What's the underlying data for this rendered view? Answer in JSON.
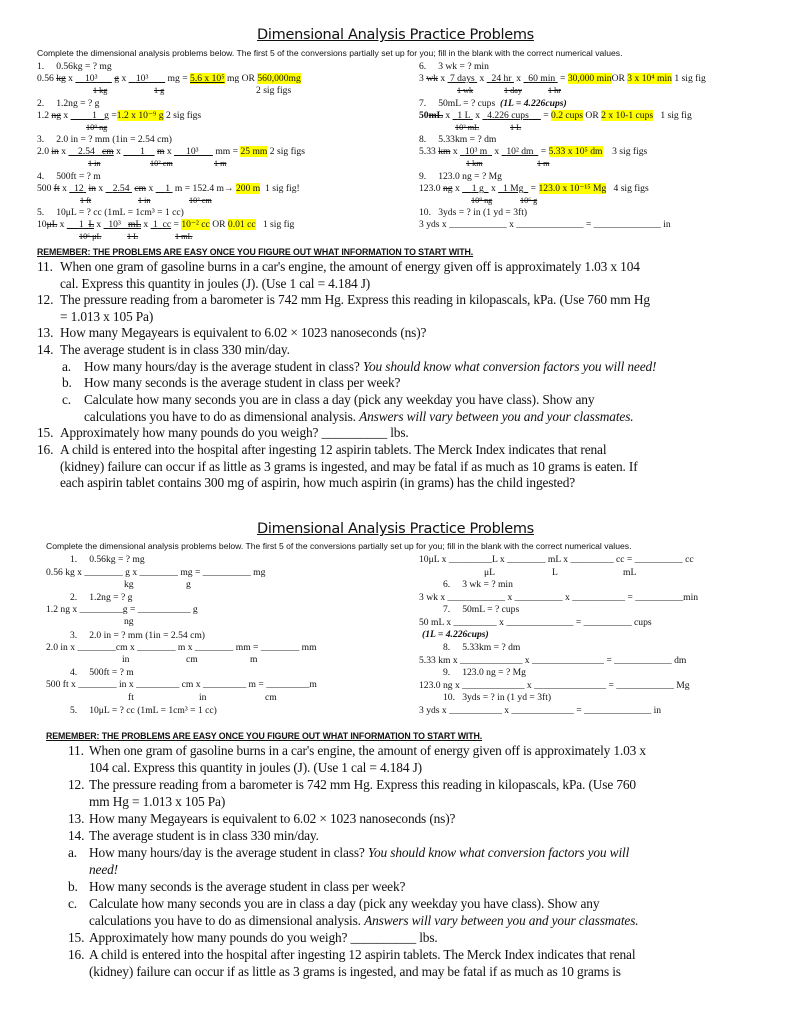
{
  "worksheet_title": "Dimensional Analysis Practice Problems",
  "instructions": "Complete the dimensional analysis problems below.  The first 5 of the conversions partially set up for you; fill in the blank with the correct numerical values.",
  "highlight_color": "#ffff00",
  "answer_key": {
    "p1": {
      "head": "1.     0.56kg = ? mg",
      "start": "0.56 ",
      "start_unit": "kg",
      "x": " x ",
      "f1_num": "10³",
      "f1_unit": "g",
      "f1_den": "1 kg",
      "f2_num": "10³",
      "f2_unit": "mg =",
      "f2_den": "1 g",
      "answer": "5.6 x 10⁵",
      "after": " mg OR ",
      "answer2": "560,000mg",
      "sig": "2 sig figs"
    },
    "p2": {
      "head": "2.     1.2ng = ? g",
      "start": "1.2 ",
      "start_unit": "ng",
      "f1_num": "1",
      "f1_den": "10⁹ ng",
      "eq": "g =",
      "answer": "1.2 x 10⁻⁹ g",
      "sig": "2 sig figs"
    },
    "p3": {
      "head": "3.     2.0 in = ? mm (1in = 2.54 cm)",
      "start": "2.0 ",
      "start_unit": "in",
      "f1_num": "2.54",
      "f1_unit": "cm",
      "f1_den": "1 in",
      "f2_num": "1",
      "f2_unit": "m",
      "f2_den": "10² cm",
      "f3_num": "10³",
      "f3_unit": "mm =",
      "f3_den": "1 m",
      "answer": "25 mm",
      "sig": "2 sig figs"
    },
    "p4": {
      "head": "4.     500ft = ? m",
      "start": "500 ",
      "start_unit": "ft",
      "f1_num": "12",
      "f1_unit": "in",
      "f1_den": "1 ft",
      "f2_num": "2.54",
      "f2_unit": "cm",
      "f2_den": "1 in",
      "f3_num": "1",
      "f3_unit": "m = 152.4 m→ ",
      "f3_den": "10² cm",
      "answer": "200 m",
      "sig": "1 sig fig!"
    },
    "p5": {
      "head": "5.     10μL = ? cc (1mL = 1cm³ = 1 cc)",
      "start": "10",
      "start_unit": "μL",
      "f1_num": "1",
      "f1_unit": "L",
      "f1_den": "10⁶ μL",
      "f2_num": "10³",
      "f2_unit": "mL",
      "f2_den": "1 L",
      "f3_num": "1",
      "f3_unit": "cc",
      "f3_den": "1 mL",
      "answer": "10⁻² cc",
      "or": " OR ",
      "answer2": "0.01 cc",
      "sig": "1 sig fig"
    },
    "p6": {
      "head": "6.     3 wk = ? min",
      "start": "3 ",
      "start_unit": "wk",
      "f1_num": "7 days",
      "f1_den": "1 wk",
      "f2_num": "24 hr",
      "f2_den": "1 day",
      "f3_num": "60 min",
      "f3_den": "1 hr",
      "answer": "30,000 min",
      "or": "OR ",
      "answer2": "3 x 10⁴ min",
      "sig": "1 sig fig"
    },
    "p7": {
      "head": "7.     50mL = ? cups",
      "note": "(1L = 4.226cups)",
      "start": "50",
      "start_unit": "mL",
      "f1_num": "1 L",
      "f1_den": "10³ mL",
      "f2_num": "4.226 cups",
      "f2_den": "1 L",
      "answer": "0.2 cups",
      "or": " OR ",
      "answer2": "2 x 10-1 cups",
      "sig": "1 sig fig"
    },
    "p8": {
      "head": "8.     5.33km = ? dm",
      "start": "5.33 ",
      "start_unit": "km",
      "f1_num": "10³ m",
      "f1_den": "1 km",
      "f2_num": "10² dm",
      "f2_den": "1 m",
      "answer": "5.33 x 10⁵ dm",
      "sig": "3 sig figs"
    },
    "p9": {
      "head": "9.     123.0 ng = ? Mg",
      "start": "123.0 ",
      "start_unit": "ng",
      "f1_num": "1 g",
      "f1_den": "10⁹ ng",
      "f2_num": "1 Mg",
      "f2_den": "10⁶ g",
      "answer": "123.0 x 10⁻¹⁵ Mg",
      "sig": "4 sig figs"
    },
    "p10": {
      "head": "10.   3yds = ? in (1 yd = 3ft)",
      "line": "3 yds x ____________ x ______________ = ______________ in"
    }
  },
  "blank_sheet": {
    "p1": {
      "head": "1.     0.56kg = ? mg",
      "line": "0.56 kg x ________ g x ________ mg = __________ mg",
      "units": [
        "kg",
        "g"
      ]
    },
    "p2": {
      "head": "2.     1.2ng = ? g",
      "line": "1.2 ng x _________g = ___________ g",
      "units": [
        "ng"
      ]
    },
    "p3": {
      "head": "3.     2.0 in = ? mm (1in = 2.54 cm)",
      "line": "2.0 in x ________cm x ________ m x ________ mm = ________ mm",
      "units": [
        "in",
        "cm",
        "m"
      ]
    },
    "p4": {
      "head": "4.     500ft = ? m",
      "line": "500 ft x ________ in x _________ cm x _________ m = _________m",
      "units": [
        "ft",
        "in",
        "cm"
      ]
    },
    "p5": {
      "head": "5.     10μL = ? cc (1mL = 1cm³ = 1 cc)",
      "line": "10μL x _________L x ________ mL x _________ cc = __________ cc",
      "units": [
        "μL",
        "L",
        "mL"
      ]
    },
    "p6": {
      "head": "6.     3 wk = ? min",
      "line": "3 wk x ____________ x __________ x ___________ = __________min"
    },
    "p7": {
      "head": "7.     50mL = ? cups",
      "line": "50 mL x _________ x ______________ = __________ cups",
      "note": "(1L = 4.226cups)"
    },
    "p8": {
      "head": "8.     5.33km = ? dm",
      "line": "5.33 km x _____________ x _______________ = ____________ dm"
    },
    "p9": {
      "head": "9.     123.0 ng = ? Mg",
      "line": "123.0 ng x _____________ x _______________ = ____________ Mg"
    },
    "p10": {
      "head": "10.   3yds = ? in (1 yd = 3ft)",
      "line": "3 yds x ___________ x _____________ = ______________ in"
    }
  },
  "remember": "REMEMBER: THE PROBLEMS ARE EASY ONCE YOU FIGURE OUT WHAT INFORMATION TO START WITH.",
  "questions_top": [
    {
      "num": "11.",
      "lines": [
        "When one gram of gasoline burns in a car's engine, the amount of energy given off is approximately 1.03 x 104",
        "cal. Express this quantity in joules (J). (Use 1 cal = 4.184 J)"
      ]
    },
    {
      "num": "12.",
      "lines": [
        "The pressure reading from a barometer is 742 mm Hg. Express this reading in kilopascals, kPa. (Use 760 mm Hg",
        "= 1.013 x 105 Pa)"
      ]
    },
    {
      "num": "13.",
      "lines": [
        "How many Megayears is equivalent to 6.02 × 1023 nanoseconds (ns)?"
      ]
    },
    {
      "num": "14.",
      "lines": [
        "The average student is in class 330 min/day."
      ]
    },
    {
      "num": "a.",
      "text": "How many hours/day is the average student in class? ",
      "italic": "You should know what conversion factors you will need!"
    },
    {
      "num": "b.",
      "lines": [
        "How many seconds is the average student in class per week?"
      ]
    },
    {
      "num": "c.",
      "line1": "Calculate how many seconds you are in class a day (pick any weekday you have class).  Show any",
      "line2": "calculations you have to do as dimensional analysis. ",
      "italic": "Answers will vary between you and your classmates."
    },
    {
      "num": "15.",
      "lines": [
        "Approximately how many pounds do you weigh? __________ lbs."
      ]
    },
    {
      "num": "16.",
      "lines": [
        "A child is entered into the hospital after ingesting 12 aspirin tablets. The Merck Index indicates that renal",
        "(kidney) failure can occur if as little as 3 grams is ingested, and may be fatal if as much as 10 grams is eaten. If",
        "each aspirin tablet contains 300 mg of aspirin, how much aspirin (in grams) has the child ingested?"
      ]
    }
  ],
  "questions_bottom": [
    {
      "num": "11.",
      "lines": [
        "When one gram of gasoline burns in a car's engine, the amount of energy given off is approximately 1.03 x",
        "104 cal. Express this quantity in joules (J). (Use 1 cal = 4.184 J)"
      ]
    },
    {
      "num": "12.",
      "lines": [
        "The pressure reading from a barometer is 742 mm Hg. Express this reading in kilopascals, kPa. (Use 760",
        "mm Hg = 1.013 x 105 Pa)"
      ]
    },
    {
      "num": "13.",
      "lines": [
        "How many Megayears is equivalent to 6.02 × 1023 nanoseconds (ns)?"
      ]
    },
    {
      "num": "14.",
      "lines": [
        "The average student is in class 330 min/day."
      ]
    },
    {
      "num": "a.",
      "text": "How many hours/day is the average student in class? ",
      "italic": "You should know what conversion factors you will",
      "italic2": "need!"
    },
    {
      "num": "b.",
      "lines": [
        "How many seconds is the average student in class per week?"
      ]
    },
    {
      "num": "c.",
      "line1": "Calculate how many seconds you are in class a day (pick any weekday you have class).  Show any",
      "line2": "calculations you have to do as dimensional analysis. ",
      "italic": "Answers will vary between you and your classmates."
    },
    {
      "num": "15.",
      "lines": [
        "Approximately how many pounds do you weigh? __________ lbs."
      ]
    },
    {
      "num": "16.",
      "lines": [
        "A child is entered into the hospital after ingesting 12 aspirin tablets. The Merck Index indicates that renal",
        "(kidney) failure can occur if as little as 3 grams is ingested, and may be fatal if as much as 10 grams is"
      ]
    }
  ]
}
